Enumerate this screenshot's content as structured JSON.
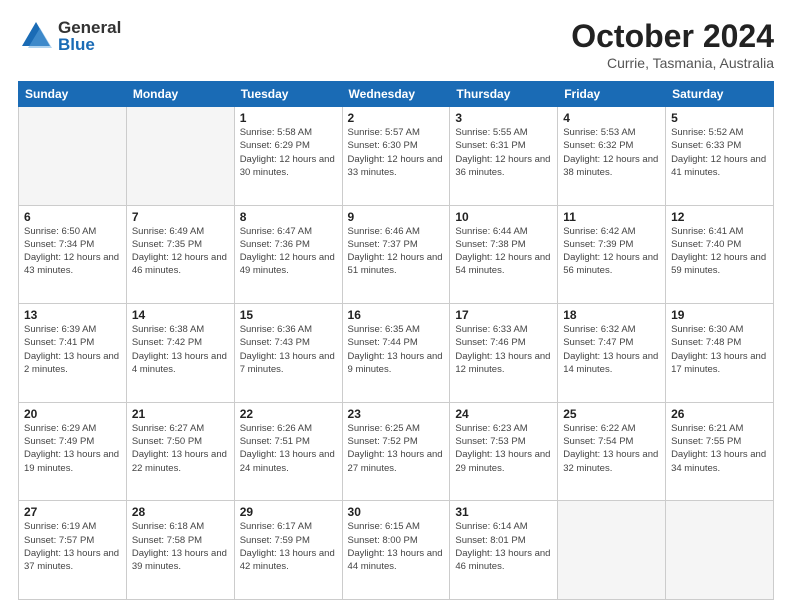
{
  "logo": {
    "general": "General",
    "blue": "Blue"
  },
  "title": "October 2024",
  "subtitle": "Currie, Tasmania, Australia",
  "headers": [
    "Sunday",
    "Monday",
    "Tuesday",
    "Wednesday",
    "Thursday",
    "Friday",
    "Saturday"
  ],
  "weeks": [
    [
      {
        "day": "",
        "info": ""
      },
      {
        "day": "",
        "info": ""
      },
      {
        "day": "1",
        "info": "Sunrise: 5:58 AM\nSunset: 6:29 PM\nDaylight: 12 hours and 30 minutes."
      },
      {
        "day": "2",
        "info": "Sunrise: 5:57 AM\nSunset: 6:30 PM\nDaylight: 12 hours and 33 minutes."
      },
      {
        "day": "3",
        "info": "Sunrise: 5:55 AM\nSunset: 6:31 PM\nDaylight: 12 hours and 36 minutes."
      },
      {
        "day": "4",
        "info": "Sunrise: 5:53 AM\nSunset: 6:32 PM\nDaylight: 12 hours and 38 minutes."
      },
      {
        "day": "5",
        "info": "Sunrise: 5:52 AM\nSunset: 6:33 PM\nDaylight: 12 hours and 41 minutes."
      }
    ],
    [
      {
        "day": "6",
        "info": "Sunrise: 6:50 AM\nSunset: 7:34 PM\nDaylight: 12 hours and 43 minutes."
      },
      {
        "day": "7",
        "info": "Sunrise: 6:49 AM\nSunset: 7:35 PM\nDaylight: 12 hours and 46 minutes."
      },
      {
        "day": "8",
        "info": "Sunrise: 6:47 AM\nSunset: 7:36 PM\nDaylight: 12 hours and 49 minutes."
      },
      {
        "day": "9",
        "info": "Sunrise: 6:46 AM\nSunset: 7:37 PM\nDaylight: 12 hours and 51 minutes."
      },
      {
        "day": "10",
        "info": "Sunrise: 6:44 AM\nSunset: 7:38 PM\nDaylight: 12 hours and 54 minutes."
      },
      {
        "day": "11",
        "info": "Sunrise: 6:42 AM\nSunset: 7:39 PM\nDaylight: 12 hours and 56 minutes."
      },
      {
        "day": "12",
        "info": "Sunrise: 6:41 AM\nSunset: 7:40 PM\nDaylight: 12 hours and 59 minutes."
      }
    ],
    [
      {
        "day": "13",
        "info": "Sunrise: 6:39 AM\nSunset: 7:41 PM\nDaylight: 13 hours and 2 minutes."
      },
      {
        "day": "14",
        "info": "Sunrise: 6:38 AM\nSunset: 7:42 PM\nDaylight: 13 hours and 4 minutes."
      },
      {
        "day": "15",
        "info": "Sunrise: 6:36 AM\nSunset: 7:43 PM\nDaylight: 13 hours and 7 minutes."
      },
      {
        "day": "16",
        "info": "Sunrise: 6:35 AM\nSunset: 7:44 PM\nDaylight: 13 hours and 9 minutes."
      },
      {
        "day": "17",
        "info": "Sunrise: 6:33 AM\nSunset: 7:46 PM\nDaylight: 13 hours and 12 minutes."
      },
      {
        "day": "18",
        "info": "Sunrise: 6:32 AM\nSunset: 7:47 PM\nDaylight: 13 hours and 14 minutes."
      },
      {
        "day": "19",
        "info": "Sunrise: 6:30 AM\nSunset: 7:48 PM\nDaylight: 13 hours and 17 minutes."
      }
    ],
    [
      {
        "day": "20",
        "info": "Sunrise: 6:29 AM\nSunset: 7:49 PM\nDaylight: 13 hours and 19 minutes."
      },
      {
        "day": "21",
        "info": "Sunrise: 6:27 AM\nSunset: 7:50 PM\nDaylight: 13 hours and 22 minutes."
      },
      {
        "day": "22",
        "info": "Sunrise: 6:26 AM\nSunset: 7:51 PM\nDaylight: 13 hours and 24 minutes."
      },
      {
        "day": "23",
        "info": "Sunrise: 6:25 AM\nSunset: 7:52 PM\nDaylight: 13 hours and 27 minutes."
      },
      {
        "day": "24",
        "info": "Sunrise: 6:23 AM\nSunset: 7:53 PM\nDaylight: 13 hours and 29 minutes."
      },
      {
        "day": "25",
        "info": "Sunrise: 6:22 AM\nSunset: 7:54 PM\nDaylight: 13 hours and 32 minutes."
      },
      {
        "day": "26",
        "info": "Sunrise: 6:21 AM\nSunset: 7:55 PM\nDaylight: 13 hours and 34 minutes."
      }
    ],
    [
      {
        "day": "27",
        "info": "Sunrise: 6:19 AM\nSunset: 7:57 PM\nDaylight: 13 hours and 37 minutes."
      },
      {
        "day": "28",
        "info": "Sunrise: 6:18 AM\nSunset: 7:58 PM\nDaylight: 13 hours and 39 minutes."
      },
      {
        "day": "29",
        "info": "Sunrise: 6:17 AM\nSunset: 7:59 PM\nDaylight: 13 hours and 42 minutes."
      },
      {
        "day": "30",
        "info": "Sunrise: 6:15 AM\nSunset: 8:00 PM\nDaylight: 13 hours and 44 minutes."
      },
      {
        "day": "31",
        "info": "Sunrise: 6:14 AM\nSunset: 8:01 PM\nDaylight: 13 hours and 46 minutes."
      },
      {
        "day": "",
        "info": ""
      },
      {
        "day": "",
        "info": ""
      }
    ]
  ]
}
